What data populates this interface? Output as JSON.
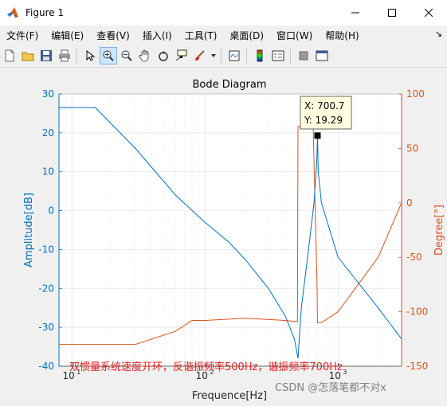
{
  "window": {
    "title": "Figure 1"
  },
  "menubar": {
    "items": [
      "文件(F)",
      "编辑(E)",
      "查看(V)",
      "插入(I)",
      "工具(T)",
      "桌面(D)",
      "窗口(W)",
      "帮助(H)"
    ]
  },
  "toolbar": {
    "icons": [
      "new-figure-icon",
      "open-file-icon",
      "save-icon",
      "print-icon",
      "select-arrow-icon",
      "zoom-in-icon",
      "zoom-out-icon",
      "pan-hand-icon",
      "rotate-3d-icon",
      "data-cursor-icon",
      "brush-icon",
      "link-plot-icon",
      "colorbar-icon",
      "legend-icon",
      "hide-tools-icon",
      "dock-icon"
    ],
    "active": "zoom-in-icon"
  },
  "plot": {
    "title": "Bode Diagram",
    "xlabel": "Frequence[Hz]",
    "ylabel_left": "Amplitude[dB]",
    "ylabel_right": "Degree[°]",
    "left_ticks": [
      "30",
      "20",
      "10",
      "0",
      "-10",
      "-20",
      "-30",
      "-40"
    ],
    "right_ticks": [
      "100",
      "50",
      "0",
      "-50",
      "-100",
      "-150"
    ],
    "xtick_base": "10",
    "xtick_exps": [
      "1",
      "2",
      "3"
    ],
    "datatip_x": "X: 700.7",
    "datatip_y": "Y: 19.29",
    "annotation": "双惯量系统速度开环，反谐振频率500Hz，谐振频率700Hz",
    "watermark": "CSDN @怎落笔都不对x",
    "colors": {
      "amplitude": "#0072bd",
      "phase": "#d95319",
      "annotation": "#e02020"
    }
  },
  "chart_data": {
    "type": "line",
    "title": "Bode Diagram",
    "xlabel": "Frequence[Hz]",
    "ylabel": "Amplitude[dB]",
    "ylabel_right": "Degree[°]",
    "xscale": "log",
    "xlim": [
      8,
      3000
    ],
    "ylim": [
      -40,
      30
    ],
    "ylim_right": [
      -150,
      100
    ],
    "grid": true,
    "series": [
      {
        "axis": "left",
        "x": [
          8,
          15,
          30,
          60,
          100,
          150,
          200,
          300,
          400,
          470,
          500,
          530,
          600,
          660,
          690,
          700.7,
          710,
          750,
          1000,
          2000,
          3000
        ],
        "y": [
          26.5,
          26.5,
          16,
          4,
          -3,
          -8,
          -12.5,
          -20,
          -27,
          -33,
          -38,
          -25,
          -10,
          2,
          12,
          19.29,
          10,
          2,
          -12,
          -25,
          -33
        ]
      },
      {
        "axis": "right",
        "x": [
          8,
          15,
          30,
          60,
          80,
          100,
          200,
          400,
          480,
          495,
          500,
          505,
          650,
          695,
          700,
          705,
          750,
          1000,
          2000,
          3000
        ],
        "y": [
          -130,
          -130,
          -130,
          -118,
          -108,
          -108,
          -106,
          -108,
          -109,
          -109,
          70,
          70,
          70,
          -75,
          -110,
          -110,
          -110,
          -100,
          -50,
          0
        ]
      }
    ],
    "datatip": {
      "x": 700.7,
      "y": 19.29
    }
  }
}
